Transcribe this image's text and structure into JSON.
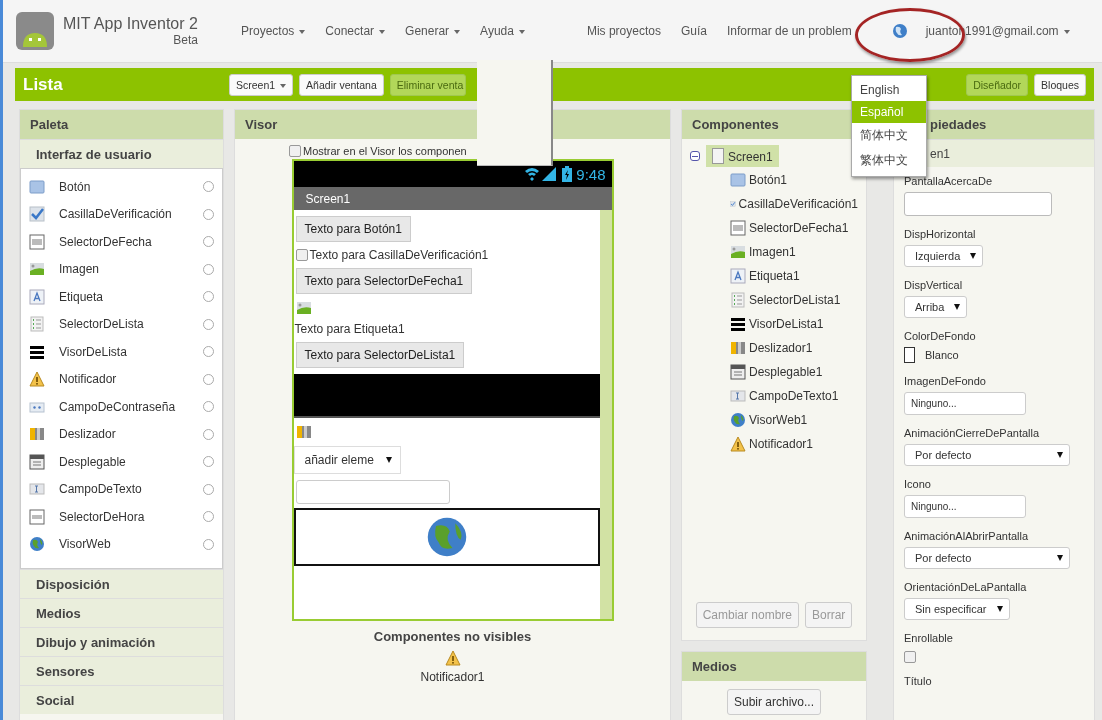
{
  "header": {
    "app_title": "MIT App Inventor 2",
    "badge": "Beta",
    "menus": [
      {
        "label": "Proyectos"
      },
      {
        "label": "Conectar"
      },
      {
        "label": "Generar"
      },
      {
        "label": "Ayuda"
      }
    ],
    "links": [
      "Mis proyectos",
      "Guía",
      "Informar de un problem"
    ],
    "account": "juanton1991@gmail.com"
  },
  "language_menu": [
    {
      "label": "English",
      "selected": false
    },
    {
      "label": "Español",
      "selected": true
    },
    {
      "label": "简体中文",
      "selected": false
    },
    {
      "label": "繁体中文",
      "selected": false
    }
  ],
  "toolbar": {
    "project": "Lista",
    "screen": "Screen1",
    "buttons": [
      "Añadir ventana",
      "Eliminar venta"
    ],
    "modes": [
      {
        "label": "Diseñador",
        "selected": true
      },
      {
        "label": "Bloques",
        "selected": false
      }
    ]
  },
  "palette": {
    "title": "Paleta",
    "open_section": "Interfaz de usuario",
    "items": [
      {
        "label": "Botón",
        "kind": "button"
      },
      {
        "label": "CasillaDeVerificación",
        "kind": "checkbox"
      },
      {
        "label": "SelectorDeFecha",
        "kind": "date"
      },
      {
        "label": "Imagen",
        "kind": "image"
      },
      {
        "label": "Etiqueta",
        "kind": "label"
      },
      {
        "label": "SelectorDeLista",
        "kind": "listpicker"
      },
      {
        "label": "VisorDeLista",
        "kind": "listview"
      },
      {
        "label": "Notificador",
        "kind": "notifier"
      },
      {
        "label": "CampoDeContraseña",
        "kind": "password"
      },
      {
        "label": "Deslizador",
        "kind": "slider"
      },
      {
        "label": "Desplegable",
        "kind": "spinner"
      },
      {
        "label": "CampoDeTexto",
        "kind": "textbox"
      },
      {
        "label": "SelectorDeHora",
        "kind": "time"
      },
      {
        "label": "VisorWeb",
        "kind": "web"
      }
    ],
    "sections": [
      "Disposición",
      "Medios",
      "Dibujo y animación",
      "Sensores",
      "Social"
    ]
  },
  "viewer": {
    "title": "Visor",
    "show_hidden": {
      "label": "Mostrar en el Visor los componen",
      "checked": false
    },
    "phone": {
      "time": "9:48",
      "screen_title": "Screen1",
      "items": [
        {
          "kind": "button",
          "label": "Texto para Botón1"
        },
        {
          "kind": "checkbox",
          "label": "Texto para CasillaDeVerificación1",
          "checked": false
        },
        {
          "kind": "button",
          "label": "Texto para SelectorDeFecha1"
        },
        {
          "kind": "image"
        },
        {
          "kind": "label",
          "label": "Texto para Etiqueta1"
        },
        {
          "kind": "button",
          "label": "Texto para SelectorDeLista1"
        },
        {
          "kind": "listview"
        },
        {
          "kind": "slider"
        },
        {
          "kind": "spinner",
          "label": "añadir eleme"
        },
        {
          "kind": "textbox"
        },
        {
          "kind": "web"
        }
      ]
    },
    "nonvisible_title": "Componentes no visibles",
    "nonvisible": [
      {
        "label": "Notificador1",
        "kind": "notifier"
      }
    ]
  },
  "components": {
    "title": "Componentes",
    "tree": [
      {
        "label": "Screen1",
        "expanded": true,
        "selected": true,
        "children": [
          {
            "label": "Botón1",
            "kind": "button"
          },
          {
            "label": "CasillaDeVerificación1",
            "kind": "checkbox"
          },
          {
            "label": "SelectorDeFecha1",
            "kind": "date"
          },
          {
            "label": "Imagen1",
            "kind": "image"
          },
          {
            "label": "Etiqueta1",
            "kind": "label"
          },
          {
            "label": "SelectorDeLista1",
            "kind": "listpicker"
          },
          {
            "label": "VisorDeLista1",
            "kind": "listview"
          },
          {
            "label": "Deslizador1",
            "kind": "slider"
          },
          {
            "label": "Desplegable1",
            "kind": "spinner"
          },
          {
            "label": "CampoDeTexto1",
            "kind": "textbox"
          },
          {
            "label": "VisorWeb1",
            "kind": "web"
          },
          {
            "label": "Notificador1",
            "kind": "notifier"
          }
        ]
      }
    ],
    "buttons": [
      {
        "label": "Cambiar nombre",
        "disabled": true
      },
      {
        "label": "Borrar",
        "disabled": true
      }
    ]
  },
  "media": {
    "title": "Medios",
    "button": "Subir archivo..."
  },
  "properties": {
    "title": "piedades",
    "component": "en1",
    "items": [
      {
        "label": "PantallaAcercaDe",
        "kind": "textarea"
      },
      {
        "label": "DispHorizontal",
        "kind": "select",
        "value": "Izquierda"
      },
      {
        "label": "DispVertical",
        "kind": "select",
        "value": "Arriba"
      },
      {
        "label": "ColorDeFondo",
        "kind": "color",
        "value": "Blanco"
      },
      {
        "label": "ImagenDeFondo",
        "kind": "asset",
        "value": "Ninguno..."
      },
      {
        "label": "AnimaciónCierreDePantalla",
        "kind": "wideselect",
        "value": "Por defecto"
      },
      {
        "label": "Icono",
        "kind": "asset",
        "value": "Ninguno..."
      },
      {
        "label": "AnimaciónAlAbrirPantalla",
        "kind": "wideselect",
        "value": "Por defecto"
      },
      {
        "label": "OrientaciónDeLaPantalla",
        "kind": "select",
        "value": "Sin especificar"
      },
      {
        "label": "Enrollable",
        "kind": "checkbox",
        "checked": false
      },
      {
        "label": "Título",
        "kind": "heading"
      }
    ]
  }
}
